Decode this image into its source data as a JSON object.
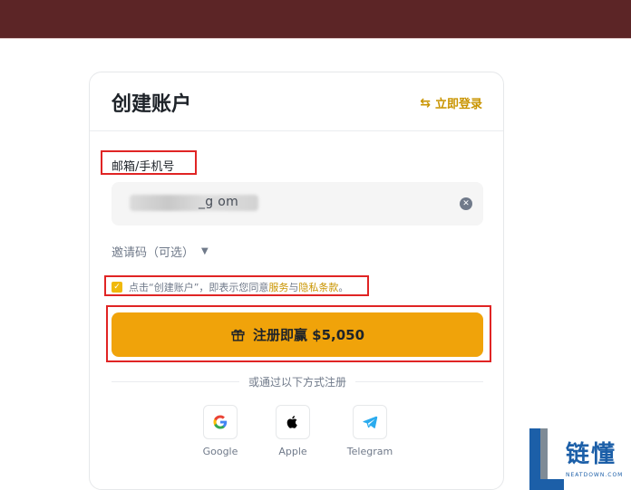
{
  "card": {
    "title": "创建账户",
    "login_link": "立即登录"
  },
  "form": {
    "email_label": "邮箱/手机号",
    "email_value_visible": "_g   om",
    "invite_label": "邀请码（可选）",
    "agreement": {
      "prefix": "点击“创建账户”，即表示您同意",
      "service_link": "服务",
      "conjunction": "与",
      "privacy_link": "隐私条款",
      "suffix": "。"
    },
    "register_button": "注册即赢 $5,050"
  },
  "social": {
    "or_text": "或通过以下方式注册",
    "providers": [
      {
        "name": "Google",
        "icon": "google-icon"
      },
      {
        "name": "Apple",
        "icon": "apple-icon"
      },
      {
        "name": "Telegram",
        "icon": "telegram-icon"
      }
    ]
  },
  "watermark": {
    "brand": "链懂",
    "sub": "NEATDOWN.COM"
  },
  "colors": {
    "accent": "#f0a30a",
    "link": "#c99400",
    "topbar": "#5c2526",
    "highlight": "#e02424"
  }
}
